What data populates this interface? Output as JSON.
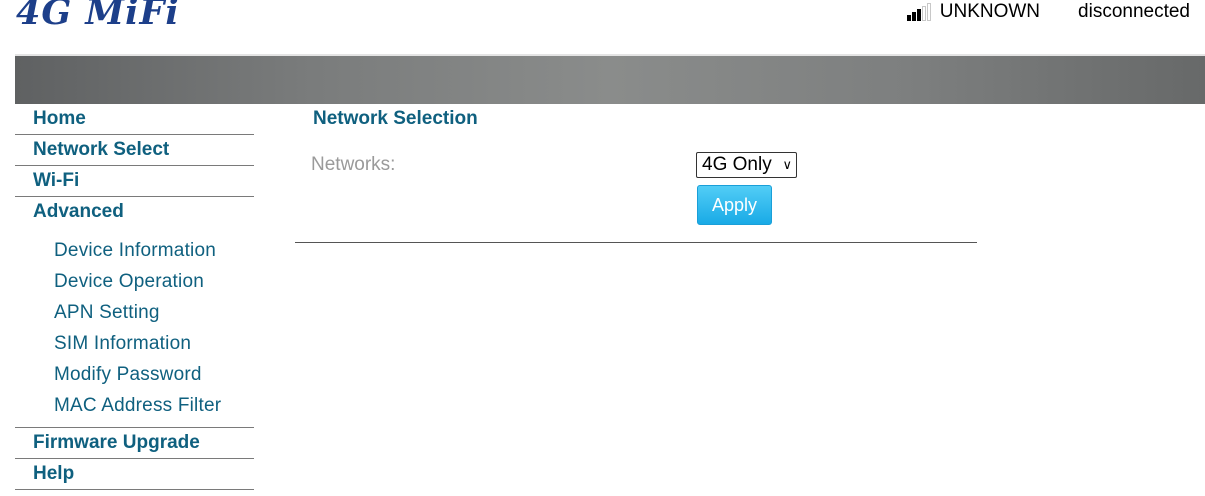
{
  "header": {
    "logo": "4G MiFi",
    "signal_bars": {
      "filled": 3,
      "total": 5
    },
    "operator": "UNKNOWN",
    "connection_status": "disconnected"
  },
  "sidebar": {
    "items": [
      {
        "label": "Home"
      },
      {
        "label": "Network Select"
      },
      {
        "label": "Wi-Fi"
      },
      {
        "label": "Advanced"
      }
    ],
    "advanced_items": [
      {
        "label": "Device Information"
      },
      {
        "label": "Device Operation"
      },
      {
        "label": "APN Setting"
      },
      {
        "label": "SIM Information"
      },
      {
        "label": "Modify Password"
      },
      {
        "label": "MAC Address Filter"
      }
    ],
    "bottom_items": [
      {
        "label": "Firmware Upgrade"
      },
      {
        "label": "Help"
      }
    ]
  },
  "main": {
    "title": "Network Selection",
    "networks_label": "Networks:",
    "networks_value": "4G Only",
    "apply_label": "Apply"
  },
  "colors": {
    "link": "#0f607f",
    "logo": "#1d3f8a",
    "button": "#19aae6",
    "label": "#9a9a9a"
  }
}
